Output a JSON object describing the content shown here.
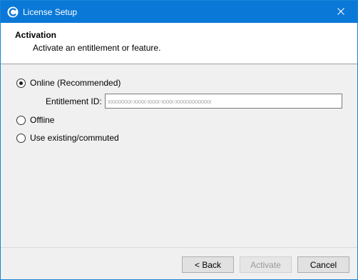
{
  "window": {
    "title": "License Setup",
    "app_icon": "app-logo-icon",
    "close_icon": "close-icon"
  },
  "header": {
    "title": "Activation",
    "subtitle": "Activate an entitlement or feature."
  },
  "options": {
    "online": {
      "label": "Online (Recommended)",
      "checked": true
    },
    "offline": {
      "label": "Offline",
      "checked": false
    },
    "existing": {
      "label": "Use existing/commuted",
      "checked": false
    }
  },
  "entitlement": {
    "label": "Entitlement ID:",
    "value": "",
    "placeholder": "xxxxxxxx-xxxx-xxxx-xxxx-xxxxxxxxxxxx"
  },
  "buttons": {
    "back": "< Back",
    "activate": "Activate",
    "activate_enabled": false,
    "cancel": "Cancel"
  },
  "colors": {
    "titlebar": "#0a78d7",
    "window_bg": "#f0f0f0"
  }
}
